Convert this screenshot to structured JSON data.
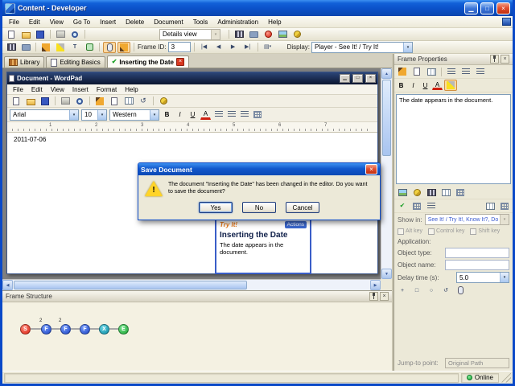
{
  "colors": {
    "titlebar_blue": "#0b51c8",
    "window_border": "#0a49c8",
    "active_toggle": "#fcd9a2",
    "node_start": "#d82010",
    "node_frame": "#1840c0",
    "node_exit": "#0888a0",
    "node_end": "#18a030",
    "online_green": "#18a030",
    "tryit_orange": "#e87818"
  },
  "icons": {
    "minimize": "▁",
    "maximize": "□",
    "close": "×",
    "dropdown": "▾",
    "first": "|◀",
    "previous": "◀",
    "next": "▶",
    "last": "▶|",
    "up": "▲",
    "down": "▼",
    "left": "◀",
    "right": "▶",
    "check": "✔",
    "undo": "↺",
    "bold": "B",
    "italic": "I",
    "underline": "U",
    "font_color": "A",
    "text_tool": "T",
    "warning": "!",
    "menu_list": "▤",
    "target": "+",
    "circle": "○",
    "square": "□"
  },
  "titlebar": {
    "title": "Content - Developer"
  },
  "menubar": {
    "items": [
      "File",
      "Edit",
      "View",
      "Go To",
      "Insert",
      "Delete",
      "Document",
      "Tools",
      "Administration",
      "Help"
    ]
  },
  "toolbar_view": {
    "details_combo": "Details view"
  },
  "toolbar_frame": {
    "frame_id_label": "Frame ID:",
    "frame_id_value": "3",
    "display_label": "Display:",
    "display_value": "Player - See It! / Try It!"
  },
  "tabs": {
    "items": [
      {
        "label": "Library"
      },
      {
        "label": "Editing Basics"
      },
      {
        "label": "Inserting the Date"
      }
    ]
  },
  "wordpad": {
    "title": "Document - WordPad",
    "menu": [
      "File",
      "Edit",
      "View",
      "Insert",
      "Format",
      "Help"
    ],
    "font_name": "Arial",
    "font_size": "10",
    "script": "Western",
    "ruler_marks": [
      "1",
      "2",
      "3",
      "4",
      "5",
      "6",
      "7"
    ],
    "document_text": "2011-07-06"
  },
  "dialog": {
    "title": "Save Document",
    "message": "The document \"Inserting the Date\" has been changed in the editor. Do you want to save the document?",
    "yes": "Yes",
    "no": "No",
    "cancel": "Cancel"
  },
  "popup": {
    "tryit_label": "Try It!",
    "actions_label": "Actions",
    "heading": "Inserting the Date",
    "body": "The date appears in the document."
  },
  "frame_structure": {
    "title": "Frame Structure",
    "nodes": [
      {
        "label": "S",
        "badge": "",
        "color": "#d82010"
      },
      {
        "label": "F",
        "badge": "2",
        "color": "#1840c0"
      },
      {
        "label": "F",
        "badge": "2",
        "color": "#1840c0"
      },
      {
        "label": "F",
        "badge": "",
        "color": "#1840c0"
      },
      {
        "label": "X",
        "badge": "",
        "color": "#0888a0"
      },
      {
        "label": "E",
        "badge": "",
        "color": "#18a030"
      }
    ]
  },
  "frame_properties": {
    "title": "Frame Properties",
    "note_text": "The date appears in the document.",
    "show_in_label": "Show in:",
    "show_in_value": "See It! / Try It!, Know It?, Do It!",
    "alt_key": "Alt key",
    "control_key": "Control key",
    "shift_key": "Shift key",
    "application_label": "Application:",
    "object_type_label": "Object type:",
    "object_name_label": "Object name:",
    "delay_label": "Delay time (s):",
    "delay_value": "5.0",
    "jump_label": "Jump-to point:",
    "jump_value": "Original Path"
  },
  "statusbar": {
    "online": "Online"
  }
}
